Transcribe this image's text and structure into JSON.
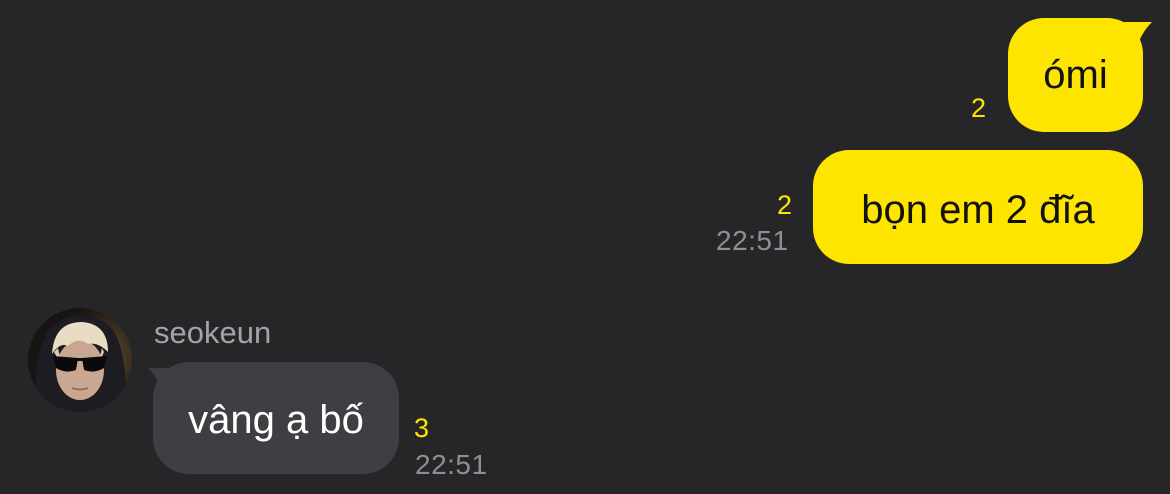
{
  "chat": {
    "messages": [
      {
        "direction": "outgoing",
        "text": "ómi",
        "unread_count": "2"
      },
      {
        "direction": "outgoing",
        "text": "bọn em 2 đĩa",
        "unread_count": "2",
        "time": "22:51"
      },
      {
        "direction": "incoming",
        "sender": "seokeun",
        "text": "vâng ạ bố",
        "unread_count": "3",
        "time": "22:51"
      }
    ]
  },
  "colors": {
    "background": "#262628",
    "outgoing_bubble": "#fee500",
    "incoming_bubble": "#3f3f43",
    "unread_count": "#fee500",
    "timestamp": "#8e8e93"
  },
  "icons": {
    "avatar": "user-avatar-sunglasses"
  }
}
